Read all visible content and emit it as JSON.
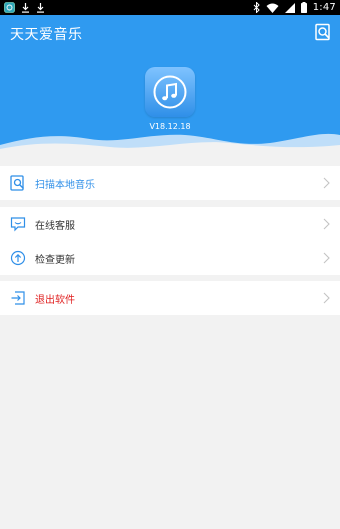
{
  "status_bar": {
    "time": "1:47"
  },
  "header": {
    "title": "天天爱音乐",
    "version": "V18.12.18"
  },
  "menu": {
    "scan": "扫描本地音乐",
    "service": "在线客服",
    "update": "检查更新",
    "exit": "退出软件"
  },
  "colors": {
    "primary": "#2f9af0",
    "scan_label": "#2f8fe8",
    "exit_label": "#e02020"
  }
}
